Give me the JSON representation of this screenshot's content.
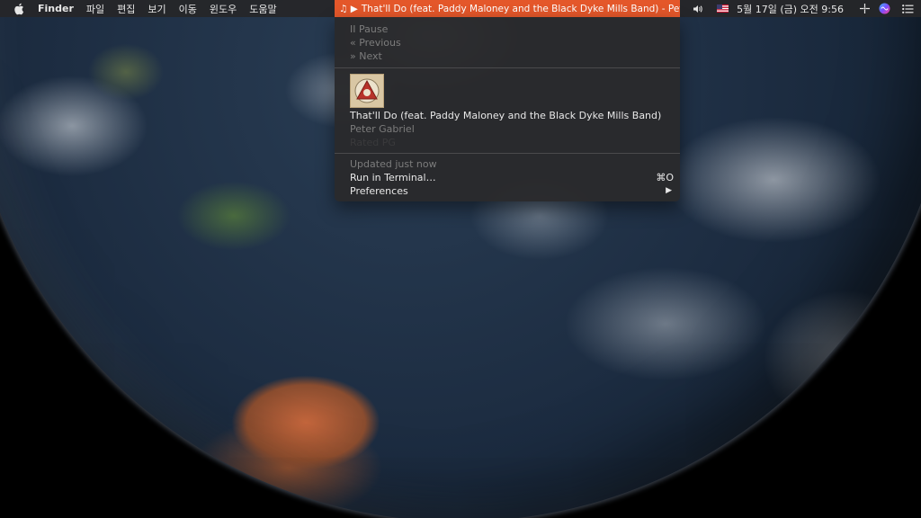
{
  "menubar": {
    "app_name": "Finder",
    "menus": [
      "파일",
      "편집",
      "보기",
      "이동",
      "윈도우",
      "도움말"
    ],
    "now_playing": {
      "text": "That'll Do (feat. Paddy Maloney and the Black Dyke Mills Band) - Peter Gabriel",
      "accent_color": "#e4572a",
      "icon": "music-note-play-icon"
    },
    "status_icons": [
      "volume-icon",
      "us-flag-input-icon",
      "airplay-icon",
      "siri-icon",
      "notification-center-icon"
    ],
    "clock": "5월 17일 (금) 오전  9:56"
  },
  "dropdown": {
    "controls": {
      "pause_label": "II Pause",
      "previous_label": "« Previous",
      "next_label": "» Next"
    },
    "track": {
      "title": "That'll Do (feat. Paddy Maloney and the Black Dyke Mills Band)",
      "artist": "Peter Gabriel",
      "album": "Rated PG"
    },
    "status": "Updated just now",
    "run_in_terminal": {
      "label": "Run in Terminal…",
      "shortcut": "⌘O"
    },
    "preferences": {
      "label": "Preferences"
    }
  }
}
